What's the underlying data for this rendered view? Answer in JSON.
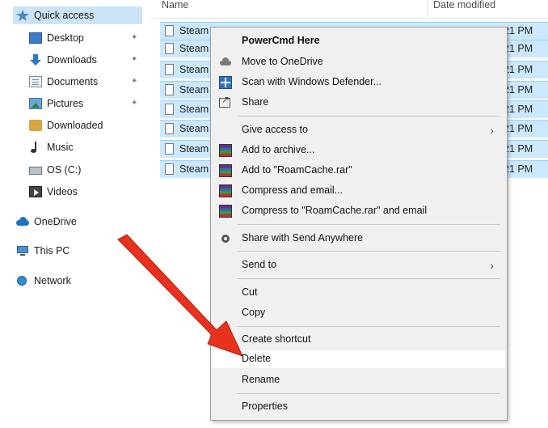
{
  "sidebar": {
    "quick_access": "Quick access",
    "items": [
      {
        "label": "Desktop",
        "icon": "desktop-icon",
        "pinned": true
      },
      {
        "label": "Downloads",
        "icon": "downloads-icon",
        "pinned": true
      },
      {
        "label": "Documents",
        "icon": "documents-icon",
        "pinned": true
      },
      {
        "label": "Pictures",
        "icon": "pictures-icon",
        "pinned": true
      },
      {
        "label": "Downloaded",
        "icon": "folder-icon",
        "pinned": false
      },
      {
        "label": "Music",
        "icon": "music-icon",
        "pinned": false
      },
      {
        "label": "OS (C:)",
        "icon": "drive-icon",
        "pinned": false
      },
      {
        "label": "Videos",
        "icon": "videos-icon",
        "pinned": false
      }
    ],
    "onedrive": "OneDrive",
    "this_pc": "This PC",
    "network": "Network"
  },
  "file_list": {
    "columns": {
      "name": "Name",
      "date": "Date modified"
    },
    "rows": [
      {
        "name": "Steam",
        "time": "21 PM"
      },
      {
        "name": "Steam",
        "time": "21 PM"
      },
      {
        "name": "Steam",
        "time": "21 PM"
      },
      {
        "name": "Steam",
        "time": "21 PM"
      },
      {
        "name": "Steam",
        "time": "21 PM"
      },
      {
        "name": "Steam",
        "time": "21 PM"
      },
      {
        "name": "Steam",
        "time": "21 PM"
      },
      {
        "name": "Steam",
        "time": "21 PM"
      }
    ]
  },
  "context_menu": {
    "powercmd": "PowerCmd Here",
    "move_onedrive": "Move to OneDrive",
    "scan_defender": "Scan with Windows Defender...",
    "share": "Share",
    "give_access": "Give access to",
    "add_archive": "Add to archive...",
    "add_rar": "Add to \"RoamCache.rar\"",
    "compress_email": "Compress and email...",
    "compress_rar_email": "Compress to \"RoamCache.rar\" and email",
    "share_send_anywhere": "Share with Send Anywhere",
    "send_to": "Send to",
    "cut": "Cut",
    "copy": "Copy",
    "create_shortcut": "Create shortcut",
    "delete": "Delete",
    "rename": "Rename",
    "properties": "Properties",
    "submenu_arrow": "›"
  },
  "pin_glyph": "📌",
  "colors": {
    "selection": "#cce8ff",
    "menu_bg": "#f0f0f0",
    "arrow": "#e8321e"
  }
}
